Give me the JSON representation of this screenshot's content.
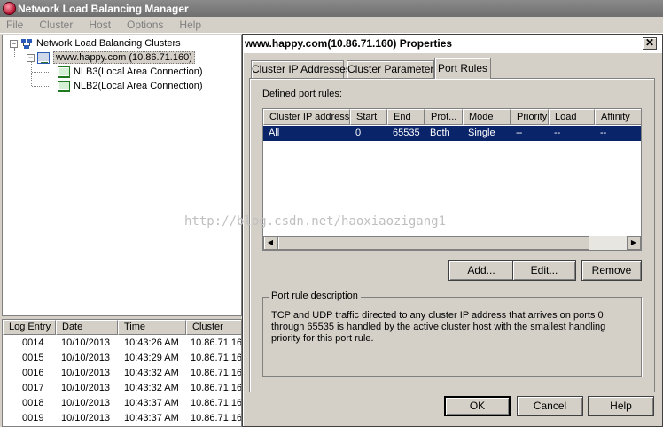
{
  "app": {
    "title": "Network Load Balancing Manager",
    "menu": [
      "File",
      "Cluster",
      "Host",
      "Options",
      "Help"
    ]
  },
  "tree": {
    "root_label": "Network Load Balancing Clusters",
    "cluster_label": "www.happy.com (10.86.71.160)",
    "hosts": [
      "NLB3(Local Area Connection)",
      "NLB2(Local Area Connection)"
    ],
    "expander_symbol": "−"
  },
  "log": {
    "columns": [
      "Log Entry",
      "Date",
      "Time",
      "Cluster"
    ],
    "rows": [
      [
        "0014",
        "10/10/2013",
        "10:43:26 AM",
        "10.86.71.16"
      ],
      [
        "0015",
        "10/10/2013",
        "10:43:29 AM",
        "10.86.71.16"
      ],
      [
        "0016",
        "10/10/2013",
        "10:43:32 AM",
        "10.86.71.16"
      ],
      [
        "0017",
        "10/10/2013",
        "10:43:32 AM",
        "10.86.71.16"
      ],
      [
        "0018",
        "10/10/2013",
        "10:43:37 AM",
        "10.86.71.16"
      ],
      [
        "0019",
        "10/10/2013",
        "10:43:37 AM",
        "10.86.71.16"
      ]
    ]
  },
  "dialog": {
    "title": "www.happy.com(10.86.71.160) Properties",
    "close_glyph": "✕",
    "tabs": [
      "Cluster IP Addresses",
      "Cluster Parameters",
      "Port Rules"
    ],
    "active_tab": "Port Rules",
    "defined_rules_label": "Defined port rules:",
    "table_columns": [
      "Cluster IP address",
      "Start",
      "End",
      "Prot...",
      "Mode",
      "Priority",
      "Load",
      "Affinity"
    ],
    "rule_row": [
      "All",
      "0",
      "65535",
      "Both",
      "Single",
      "--",
      "--",
      "--"
    ],
    "buttons": {
      "add": "Add...",
      "edit": "Edit...",
      "remove": "Remove",
      "ok": "OK",
      "cancel": "Cancel",
      "help": "Help"
    },
    "description_legend": "Port rule description",
    "description_text": "TCP and UDP traffic directed to any cluster IP address that arrives on ports 0 through 65535 is handled by the active cluster host with the smallest handling priority for this port rule."
  },
  "watermark": "http://blog.csdn.net/haoxiaozigang1",
  "colors": {
    "selection": "#0a246a",
    "title_bar": "#6f6f6f",
    "window_bg": "#d4d0c8"
  }
}
